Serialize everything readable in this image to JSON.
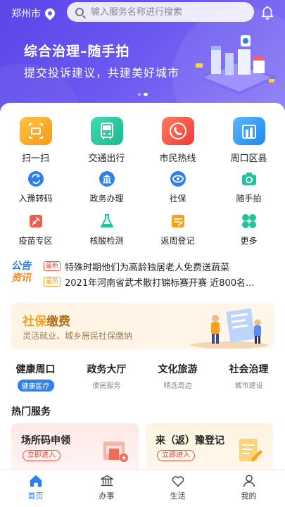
{
  "header": {
    "city": "郑州市",
    "search_placeholder": "输入服务名称进行搜索"
  },
  "banner": {
    "title": "综合治理–随手拍",
    "subtitle": "提交投诉建议，共建美好城市"
  },
  "main_services": [
    {
      "label": "扫一扫",
      "icon": "scan-icon",
      "color": "#f7a11a"
    },
    {
      "label": "交通出行",
      "icon": "bus-icon",
      "color": "#22c39a"
    },
    {
      "label": "市民热线",
      "icon": "hotline-icon",
      "color": "#f25a4a"
    },
    {
      "label": "周口区县",
      "icon": "city-buildings-icon",
      "color": "#2f9bf0"
    }
  ],
  "services_row1": [
    {
      "label": "入豫转码",
      "icon": "transcode-icon"
    },
    {
      "label": "政务办理",
      "icon": "government-icon"
    },
    {
      "label": "社保",
      "icon": "social-security-icon"
    },
    {
      "label": "随手拍",
      "icon": "camera-icon"
    }
  ],
  "services_row2": [
    {
      "label": "疫苗专区",
      "icon": "vaccine-icon"
    },
    {
      "label": "核酸检测",
      "icon": "flask-icon"
    },
    {
      "label": "返周登记",
      "icon": "register-icon"
    },
    {
      "label": "更多",
      "icon": "more-icon"
    }
  ],
  "news": {
    "logo_line1": "公告",
    "logo_line2": "资讯",
    "items": [
      {
        "badge": "最新",
        "text": "特殊时期他们为高龄独居老人免费送蔬菜"
      },
      {
        "badge": "最热",
        "text": "2021年河南省武术散打锦标赛开赛 近800名..."
      }
    ]
  },
  "social_security": {
    "title_part1": "社保",
    "title_part2": "缴费",
    "subtitle": "灵活就业、城乡居民社保缴纳"
  },
  "categories": [
    {
      "title": "健康周口",
      "sub": "健康医疗"
    },
    {
      "title": "政务大厅",
      "sub": "便民服务"
    },
    {
      "title": "文化旅游",
      "sub": "精选周边"
    },
    {
      "title": "社会治理",
      "sub": "城市建设"
    }
  ],
  "hot_services": {
    "title": "热门服务",
    "items": [
      {
        "title": "场所码申领",
        "button": "立即进入"
      },
      {
        "title": "来（返）豫登记",
        "button": "立即进入"
      }
    ]
  },
  "tabs": [
    {
      "label": "首页",
      "active": true
    },
    {
      "label": "办事",
      "active": false
    },
    {
      "label": "生活",
      "active": false
    },
    {
      "label": "我的",
      "active": false
    }
  ],
  "colors": {
    "brand": "#5a46e8",
    "accent_blue": "#2f80ed",
    "accent_orange": "#f7a11a",
    "badge_new": "#e84b3c",
    "badge_hot": "#f0a020"
  }
}
